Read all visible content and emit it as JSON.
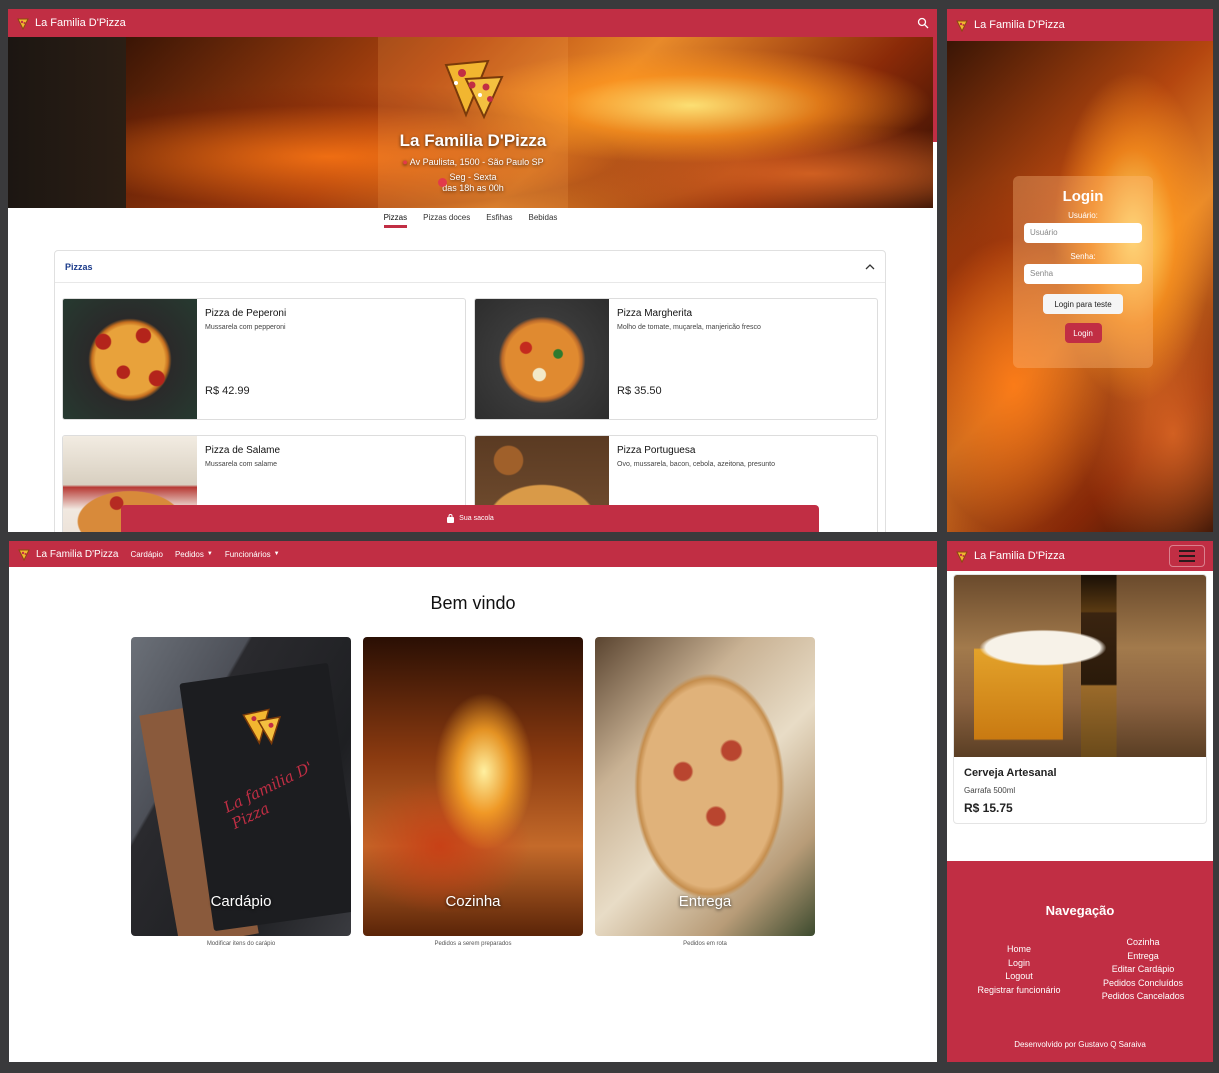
{
  "brand": "La Familia D'Pizza",
  "colors": {
    "primary": "#c12e44",
    "background": "#3a3a3c"
  },
  "menu_page": {
    "hero": {
      "title": "La Familia D'Pizza",
      "address": "Av Paulista, 1500 - São Paulo SP",
      "days": "Seg - Sexta",
      "hours": "das 18h as 00h"
    },
    "tabs": [
      "Pizzas",
      "Pizzas doces",
      "Esfihas",
      "Bebidas"
    ],
    "section_title": "Pizzas",
    "items": [
      {
        "name": "Pizza de Peperoni",
        "desc": "Mussarela com pepperoni",
        "price": "R$ 42.99"
      },
      {
        "name": "Pizza Margherita",
        "desc": "Molho de tomate, muçarela, manjericão fresco",
        "price": "R$ 35.50"
      },
      {
        "name": "Pizza de Salame",
        "desc": "Mussarela com salame",
        "price": ""
      },
      {
        "name": "Pizza Portuguesa",
        "desc": "Ovo, mussarela, bacon, cebola, azeitona, presunto",
        "price": ""
      }
    ],
    "bag_label": "Sua sacola"
  },
  "login": {
    "title": "Login",
    "user_label": "Usuário:",
    "user_placeholder": "Usuário",
    "pass_label": "Senha:",
    "pass_placeholder": "Senha",
    "test_button": "Login para teste",
    "login_button": "Login"
  },
  "dashboard": {
    "nav": [
      "Cardápio",
      "Pedidos",
      "Funcionários"
    ],
    "welcome": "Bem vindo",
    "cards": [
      {
        "title": "Cardápio",
        "sub": "Modificar itens do carápio"
      },
      {
        "title": "Cozinha",
        "sub": "Pedidos a serem preparados"
      },
      {
        "title": "Entrega",
        "sub": "Pedidos em rota"
      }
    ],
    "menu_book_text": "La familia D' Pizza"
  },
  "mobile": {
    "product": {
      "name": "Cerveja Artesanal",
      "desc": "Garrafa 500ml",
      "price": "R$ 15.75"
    },
    "footer": {
      "title": "Navegação",
      "left_links": [
        "Home",
        "Login",
        "Logout",
        "Registrar funcionário"
      ],
      "right_links": [
        "Cozinha",
        "Entrega",
        "Editar Cardápio",
        "Pedidos Concluídos",
        "Pedidos Cancelados"
      ],
      "credit": "Desenvolvido por Gustavo Q Saraiva"
    }
  }
}
